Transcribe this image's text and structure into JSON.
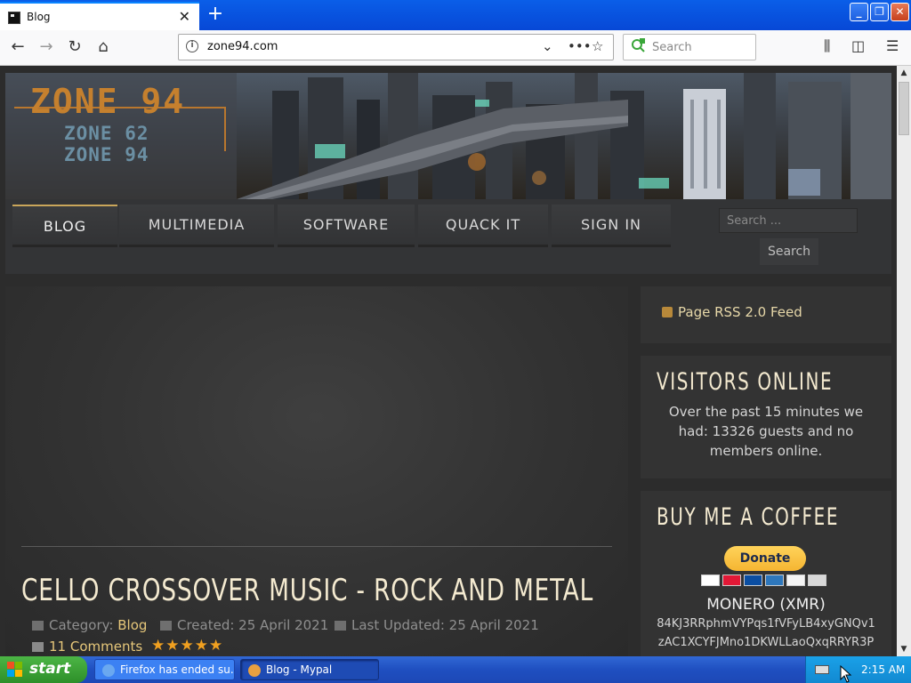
{
  "browser": {
    "tab_title": "Blog",
    "url": "zone94.com",
    "search_placeholder": "Search"
  },
  "site": {
    "logo_main": "ZONE 94",
    "logo_sub1": "ZONE 62",
    "logo_sub2": "ZONE 94",
    "menu": [
      "BLOG",
      "MULTIMEDIA",
      "SOFTWARE",
      "QUACK IT",
      "SIGN IN"
    ],
    "active_menu": "BLOG",
    "search_placeholder": "Search ...",
    "search_button": "Search"
  },
  "article": {
    "title": "CELLO CROSSOVER MUSIC - ROCK AND METAL",
    "category_label": "Category:",
    "category_value": "Blog",
    "created": "Created: 25 April 2021",
    "updated": "Last Updated: 25 April 2021",
    "comments": "11 Comments",
    "rating_stars": 5
  },
  "sidebar": {
    "rss": "Page RSS 2.0 Feed",
    "visitors_heading": "VISITORS ONLINE",
    "visitors_text": "Over the past 15 minutes we had: 13326 guests and no members online.",
    "coffee_heading": "BUY ME A COFFEE",
    "donate_label": "Donate",
    "xmr_title": "MONERO (XMR)",
    "xmr_line1": "84KJ3RRphmVYPqs1fVFyLB4xyGNQv1",
    "xmr_line2": "zAC1XCYFJMno1DKWLLaoQxqRRYR3P"
  },
  "taskbar": {
    "start": "start",
    "tasks": [
      "Firefox has ended su...",
      "Blog - Mypal"
    ],
    "clock": "2:15 AM"
  },
  "colors": {
    "accent_gold": "#e6c77a",
    "title_cream": "#f4ead0",
    "xp_blue": "#1f4fc0"
  }
}
